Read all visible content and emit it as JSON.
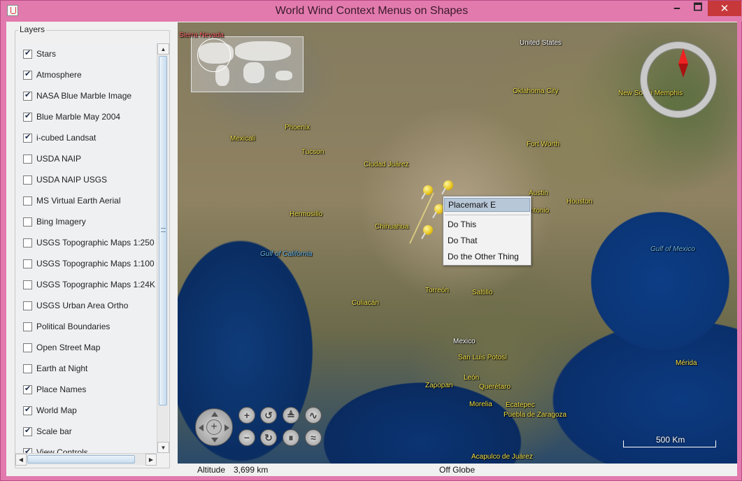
{
  "window": {
    "title": "World Wind Context Menus on Shapes",
    "minimize": "🗕",
    "maximize": "🗖",
    "close": "✕"
  },
  "layers": {
    "title": "Layers",
    "items": [
      {
        "label": "Stars",
        "checked": true
      },
      {
        "label": "Atmosphere",
        "checked": true
      },
      {
        "label": "NASA Blue Marble Image",
        "checked": true
      },
      {
        "label": "Blue Marble May 2004",
        "checked": true
      },
      {
        "label": "i-cubed Landsat",
        "checked": true
      },
      {
        "label": "USDA NAIP",
        "checked": false
      },
      {
        "label": "USDA NAIP USGS",
        "checked": false
      },
      {
        "label": "MS Virtual Earth Aerial",
        "checked": false
      },
      {
        "label": "Bing Imagery",
        "checked": false
      },
      {
        "label": "USGS Topographic Maps 1:250",
        "checked": false
      },
      {
        "label": "USGS Topographic Maps 1:100",
        "checked": false
      },
      {
        "label": "USGS Topographic Maps 1:24K",
        "checked": false
      },
      {
        "label": "USGS Urban Area Ortho",
        "checked": false
      },
      {
        "label": "Political Boundaries",
        "checked": false
      },
      {
        "label": "Open Street Map",
        "checked": false
      },
      {
        "label": "Earth at Night",
        "checked": false
      },
      {
        "label": "Place Names",
        "checked": true
      },
      {
        "label": "World Map",
        "checked": true
      },
      {
        "label": "Scale bar",
        "checked": true
      },
      {
        "label": "View Controls",
        "checked": true
      }
    ],
    "scroll_up": "▲",
    "scroll_down": "▼",
    "scroll_left": "◀",
    "scroll_right": "▶"
  },
  "map": {
    "places": {
      "sierra_nevada": "Sierra Nevada",
      "united_states": "United States",
      "oklahoma_city": "Oklahoma City",
      "new_south_memphis": "New South Memphis",
      "phoenix": "Phoenix",
      "mexicali": "Mexicali",
      "tucson": "Tucson",
      "ciudad_juarez": "Ciudad Juárez",
      "fort_worth": "Fort Worth",
      "austin": "Austin",
      "houston": "Houston",
      "antonio": "ntonio",
      "hermosillo": "Hermosillo",
      "chihuahua": "Chihuahua",
      "gulf_of_california": "Gulf of California",
      "gulf_of_mexico": "Gulf of Mexico",
      "torreon": "Torreón",
      "saltillo": "Saltillo",
      "culiacan": "Culiacán",
      "mexico": "Mexico",
      "san_luis_potosi": "San Luis Potosí",
      "leon": "León",
      "zapopan": "Zapopan",
      "queretaro": "Querétaro",
      "merida": "Mérida",
      "morelia": "Morelia",
      "ecatepec": "Ecatepec",
      "puebla": "Puebla de Zaragoza",
      "acapulco": "Acapulco de Juárez"
    },
    "context_menu": {
      "header": "Placemark E",
      "items": [
        "Do This",
        "Do That",
        "Do the Other Thing"
      ]
    },
    "scale_label": "500 Km",
    "controls": {
      "pan_center": "+",
      "zoom_in": "+",
      "zoom_out": "−",
      "heading_left": "↺",
      "heading_right": "↻",
      "pitch_up": "≜",
      "pitch_down": "⏸",
      "exaggeration_up": "∿",
      "exaggeration_down": "≈"
    }
  },
  "status": {
    "altitude_label": "Altitude",
    "altitude_value": "3,699 km",
    "globe_status": "Off Globe"
  }
}
